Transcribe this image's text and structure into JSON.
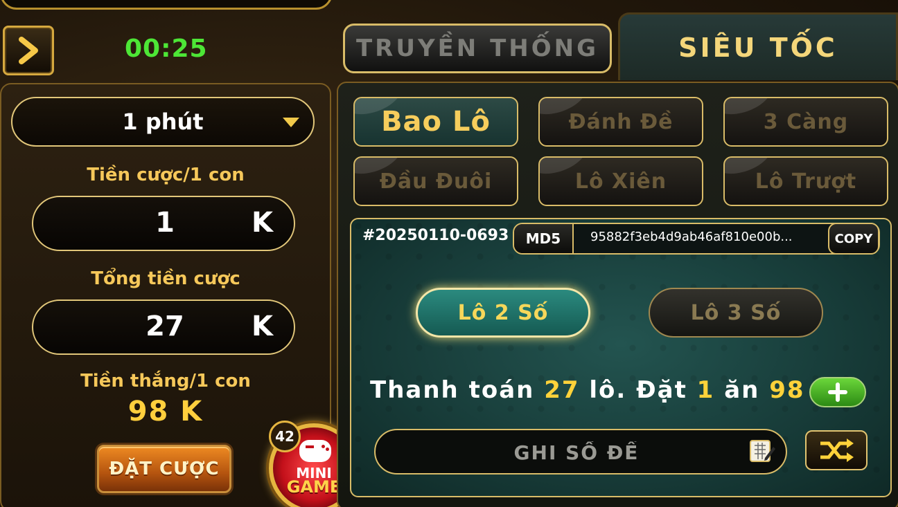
{
  "timer": "00:25",
  "tabs": {
    "traditional": "TRUYỀN THỐNG",
    "fast": "SIÊU TỐC"
  },
  "left": {
    "duration": "1 phút",
    "bet_per_label": "Tiền cược/1 con",
    "bet_per_value": "1",
    "bet_per_unit": "K",
    "total_label": "Tổng tiền cược",
    "total_value": "27",
    "total_unit": "K",
    "win_label": "Tiền thắng/1 con",
    "win_value": "98 K",
    "bet_button": "ĐẶT CƯỢC"
  },
  "mini_game": {
    "badge": "42",
    "line1": "MINI",
    "line2": "GAME"
  },
  "modes": [
    {
      "label": "Bao Lô",
      "active": true
    },
    {
      "label": "Đánh Đề",
      "active": false
    },
    {
      "label": "3 Càng",
      "active": false
    },
    {
      "label": "Đầu Đuôi",
      "active": false
    },
    {
      "label": "Lô Xiên",
      "active": false
    },
    {
      "label": "Lô Trượt",
      "active": false
    }
  ],
  "board": {
    "session_id": "#20250110-0693",
    "md5_label": "MD5",
    "hash": "95882f3eb4d9ab46af810e00b...",
    "copy_label": "COPY",
    "option_2": "Lô 2 Số",
    "option_3": "Lô 3 Số",
    "payment_prefix": "Thanh toán",
    "payment_count": "27",
    "payment_mid": "lô. Đặt",
    "payment_stake": "1",
    "payment_eat": "ăn",
    "payment_win": "98",
    "input_placeholder": "GHI SỐ ĐỀ"
  },
  "colors": {
    "timer_green": "#4de636",
    "gold": "#f6c85a",
    "teal_active": "#2b8a7f",
    "bet_orange": "#ee8a22"
  },
  "icons": [
    "chevron-right-icon",
    "caret-down-icon",
    "gamepad-icon",
    "plus-icon",
    "edit-grid-icon",
    "shuffle-icon"
  ]
}
